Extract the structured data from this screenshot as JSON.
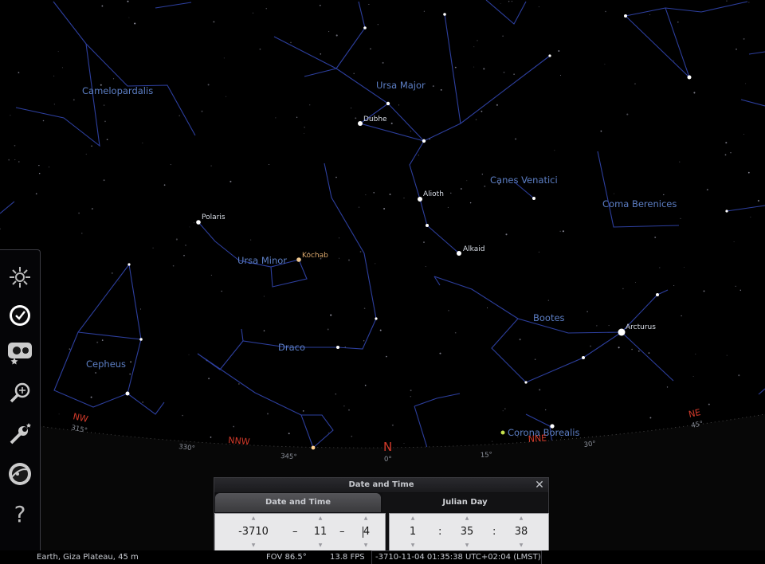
{
  "constellations": {
    "camelopardalis": "Camelopardalis",
    "ursa_major": "Ursa Major",
    "canes_venatici": "Canes Venatici",
    "coma_berenices": "Coma Berenices",
    "ursa_minor": "Ursa Minor",
    "bootes": "Bootes",
    "draco": "Draco",
    "cepheus": "Cepheus",
    "corona_borealis": "Corona Borealis"
  },
  "stars": {
    "dubhe": "Dubhe",
    "alioth": "Alioth",
    "alkaid": "Alkaid",
    "polaris": "Polaris",
    "kochab": "Kochab",
    "arcturus": "Arcturus"
  },
  "horizon": {
    "nw": "NW",
    "nnw": "NNW",
    "n": "N",
    "nne": "NNE",
    "ne": "NE",
    "deg_315": "315°",
    "deg_330": "330°",
    "deg_345": "345°",
    "deg_0": "0°",
    "deg_15": "15°",
    "deg_30": "30°",
    "deg_45": "45°"
  },
  "toolbar": {
    "items": [
      "sky-display-icon",
      "clock-icon",
      "sky-culture-icon",
      "search-icon",
      "settings-icon",
      "ocular-icon",
      "help-icon"
    ],
    "help_glyph": "?"
  },
  "dialog": {
    "title": "Date and Time",
    "close_glyph": "✕",
    "tabs": [
      "Date and Time",
      "Julian Day"
    ],
    "year": "-3710",
    "month": "11",
    "day": "4",
    "date_separator": "–",
    "hour": "1",
    "minute": "35",
    "second": "38",
    "time_separator": ":",
    "spin_up": "▲",
    "spin_down": "▼"
  },
  "status": {
    "location": "Earth, Giza Plateau, 45 m",
    "fov": "FOV 86.5°",
    "fps": "13.8 FPS",
    "datetime": "-3710-11-04 01:35:38 UTC+02:04 (LMST)"
  },
  "colors": {
    "sky": "#000000",
    "constellation_line": "#2d3f9e",
    "constellation_label": "#5c7ec4",
    "cardinal": "#d13a2a"
  }
}
